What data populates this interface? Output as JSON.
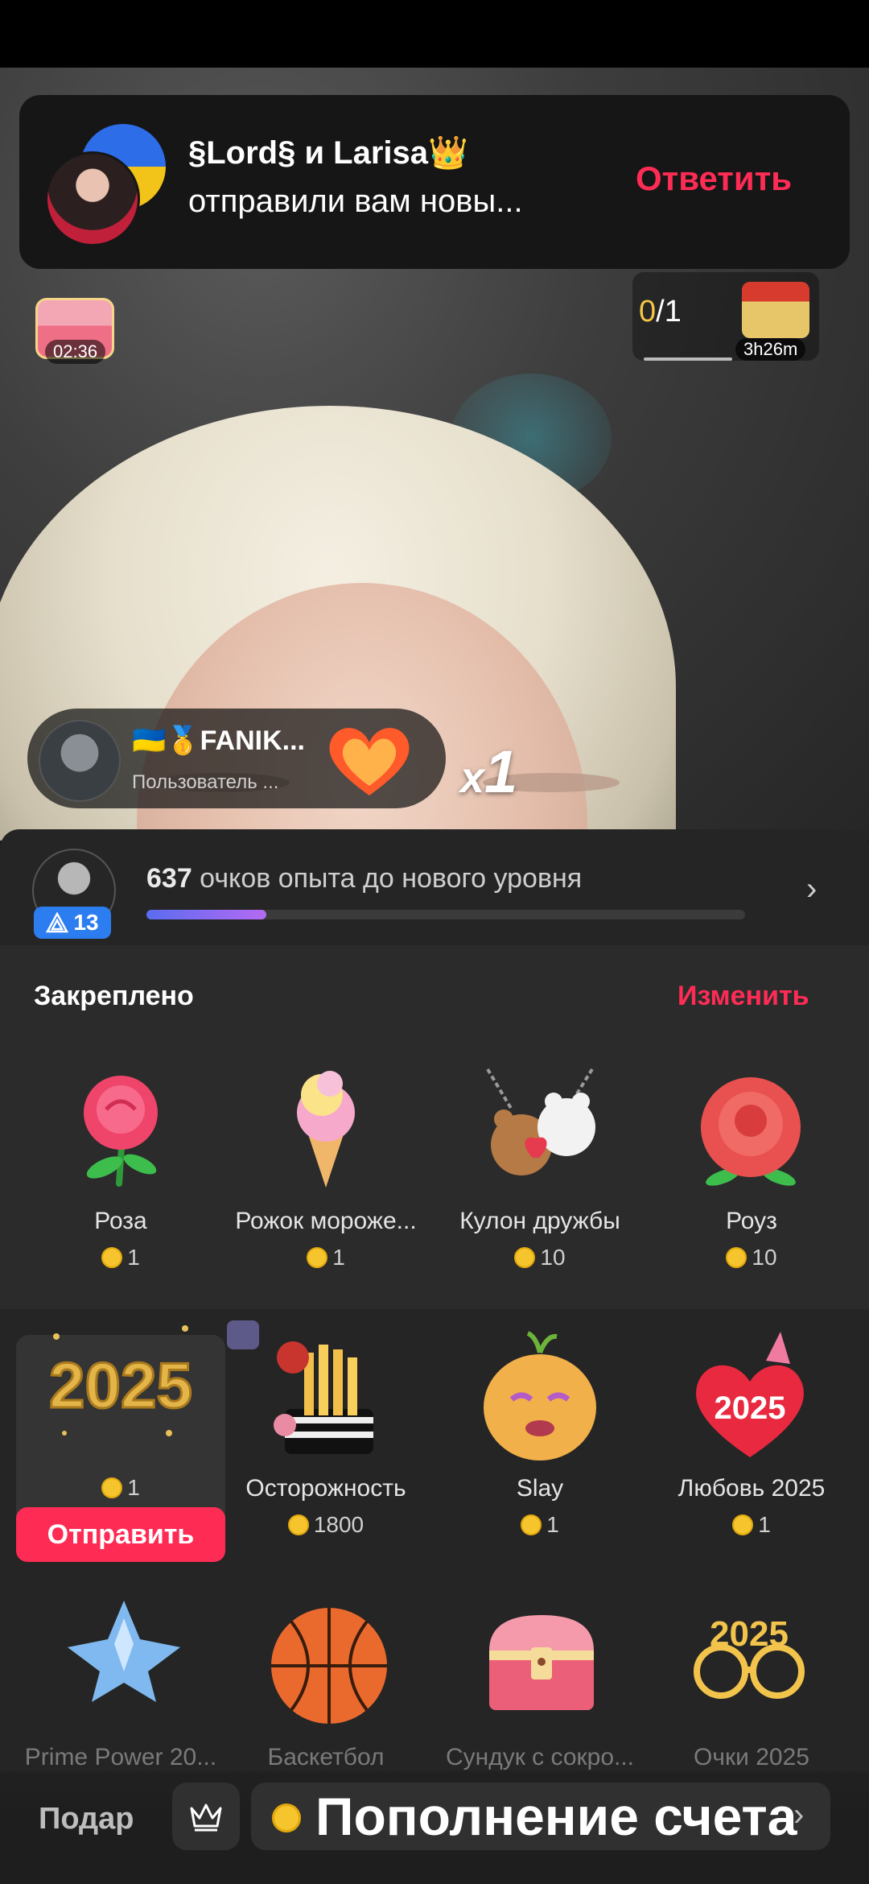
{
  "notification": {
    "title": "§Lord§ и Larisa👑",
    "subtitle": "отправили вам новы...",
    "action": "Ответить"
  },
  "stream": {
    "chest_timer": "02:36",
    "quest_progress": "0",
    "quest_total": "/1",
    "quest_timer": "3h26m",
    "gift_sender_name": "🇺🇦🥇FANIK...",
    "gift_sender_sub": "Пользователь  ...",
    "combo_prefix": "x",
    "combo_count": "1"
  },
  "level": {
    "badge": "13",
    "points": "637",
    "text": " очков опыта до нового уровня",
    "progress_fraction": 0.2
  },
  "pinned": {
    "title": "Закреплено",
    "edit": "Изменить",
    "gifts": [
      {
        "name": "Роза",
        "price": "1"
      },
      {
        "name": "Рожок мороже...",
        "price": "1"
      },
      {
        "name": "Кулон дружбы",
        "price": "10"
      },
      {
        "name": "Роуз",
        "price": "10"
      }
    ]
  },
  "gifts_row2": [
    {
      "name": "",
      "price": "1",
      "send": "Отправить"
    },
    {
      "name": "Осторожность",
      "price": "1800"
    },
    {
      "name": "Slay",
      "price": "1"
    },
    {
      "name": "Любовь 2025",
      "price": "1"
    }
  ],
  "gifts_row3": [
    {
      "name": "Prime Power 20..."
    },
    {
      "name": "Баскетбол"
    },
    {
      "name": "Сундук с сокро..."
    },
    {
      "name": "Очки 2025"
    }
  ],
  "art_text": {
    "year": "2025"
  },
  "bottom": {
    "label": "Подар",
    "topup": "Пополнение счета"
  },
  "colors": {
    "accent": "#fe2c55",
    "coin": "#f6c42c",
    "level_badge": "#2c7df0"
  }
}
